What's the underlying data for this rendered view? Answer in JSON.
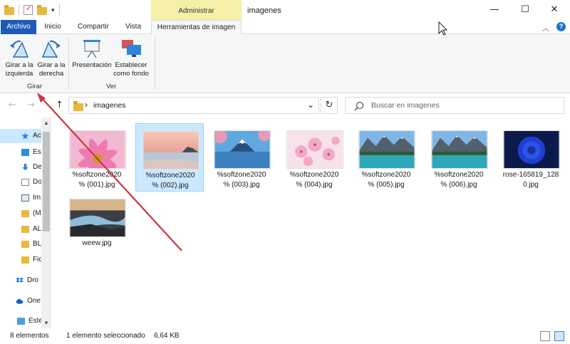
{
  "window": {
    "title": "imagenes",
    "context_tab_group": "Administrar",
    "minimize_glyph": "—",
    "maximize_glyph": "☐",
    "close_glyph": "✕"
  },
  "ribbon_tabs": {
    "archivo": "Archivo",
    "inicio": "Inicio",
    "compartir": "Compartir",
    "vista": "Vista",
    "herramientas": "Herramientas de imagen"
  },
  "ribbon_collapse_glyph": "︿",
  "help_glyph": "?",
  "ribbon": {
    "rotate_left": "Girar a la izquierda",
    "rotate_left_l1": "Girar a la",
    "rotate_left_l2": "izquierda",
    "rotate_right_l1": "Girar a la",
    "rotate_right_l2": "derecha",
    "group_rotate": "Girar",
    "slideshow": "Presentación",
    "set_bg_l1": "Establecer",
    "set_bg_l2": "como fondo",
    "group_view": "Ver"
  },
  "nav": {
    "back": "←",
    "forward": "→",
    "up": "↑",
    "chevron": "›",
    "path": "imagenes",
    "dropdown": "⌄",
    "refresh": "↻",
    "search_placeholder": "Buscar en imagenes"
  },
  "nav_pane": [
    {
      "label": "Acc",
      "icon": "star-icon"
    },
    {
      "label": "Es",
      "icon": "desktop-icon"
    },
    {
      "label": "De",
      "icon": "download-icon"
    },
    {
      "label": "Do",
      "icon": "document-icon"
    },
    {
      "label": "Im",
      "icon": "picture-icon"
    },
    {
      "label": "(M",
      "icon": "folder-icon"
    },
    {
      "label": "AL",
      "icon": "folder-icon"
    },
    {
      "label": "BL",
      "icon": "folder-icon"
    },
    {
      "label": "Fic",
      "icon": "folder-icon"
    },
    {
      "label": "Dro",
      "icon": "dropbox-icon"
    },
    {
      "label": "One",
      "icon": "onedrive-icon"
    },
    {
      "label": "Este",
      "icon": "pc-icon"
    }
  ],
  "files": [
    {
      "name_l1": "%softzone2020",
      "name_l2": "% (001).jpg"
    },
    {
      "name_l1": "%softzone2020",
      "name_l2": "% (002).jpg"
    },
    {
      "name_l1": "%softzone2020",
      "name_l2": "% (003).jpg"
    },
    {
      "name_l1": "%softzone2020",
      "name_l2": "% (004).jpg"
    },
    {
      "name_l1": "%softzone2020",
      "name_l2": "% (005).jpg"
    },
    {
      "name_l1": "%softzone2020",
      "name_l2": "% (006).jpg"
    },
    {
      "name_l1": "rose-165819_128",
      "name_l2": "0.jpg"
    },
    {
      "name_l1": "weew.jpg",
      "name_l2": ""
    }
  ],
  "status": {
    "count": "8 elementos",
    "selection": "1 elemento seleccionado",
    "size": "6,64 KB"
  },
  "colors": {
    "archivo_tab": "#1e5bb8",
    "context_tab": "#f4f0a8",
    "selection": "#cce8ff",
    "annotation_arrow": "#c8383e"
  }
}
